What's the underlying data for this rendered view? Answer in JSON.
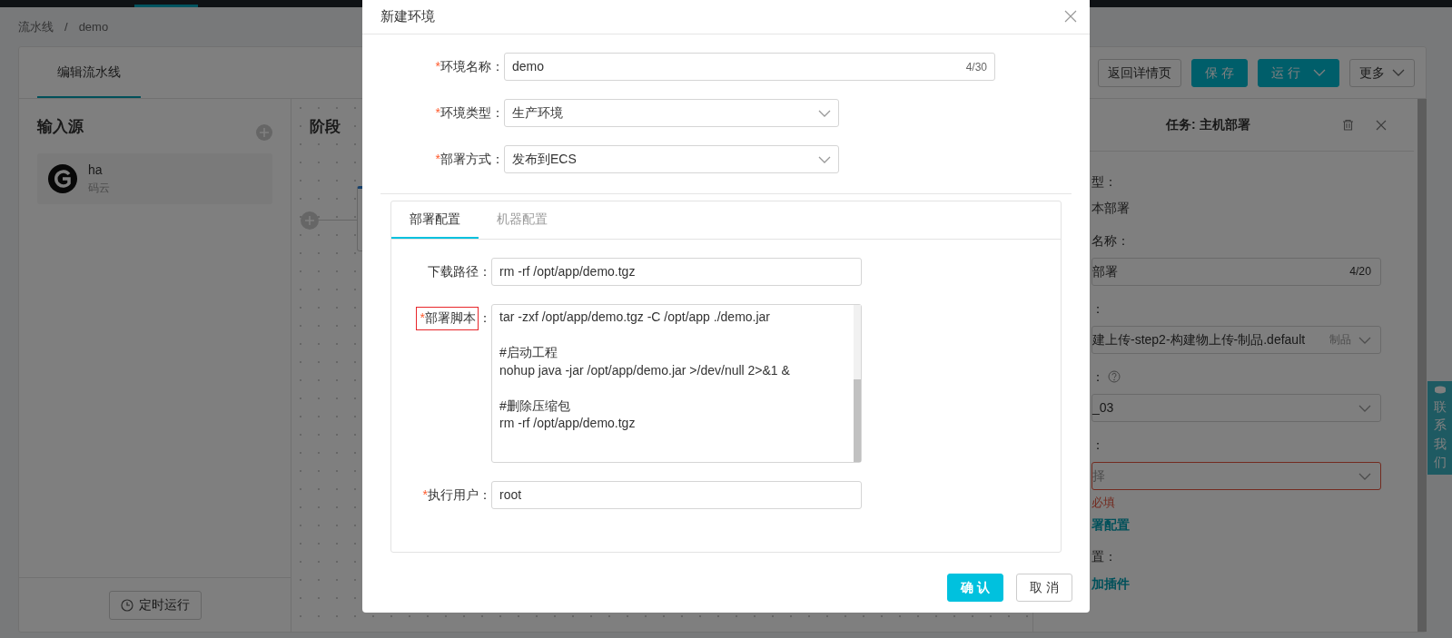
{
  "breadcrumb": {
    "items": [
      "流水线",
      "demo"
    ],
    "separator": "/"
  },
  "page_tabs": [
    {
      "label": "编辑流水线",
      "selected": true
    }
  ],
  "toolbar": [
    {
      "label": "返回详情页",
      "kind": "default"
    },
    {
      "label": "保 存",
      "kind": "primary"
    },
    {
      "label": "运 行",
      "kind": "split"
    },
    {
      "label": "更多",
      "kind": "dropdown"
    }
  ],
  "sources": {
    "title": "输入源",
    "items": [
      {
        "name": "ha",
        "provider": "码云"
      }
    ]
  },
  "schedule_button": "定时运行",
  "stages": {
    "title": "阶段"
  },
  "task_panel": {
    "title": "任务: 主机部署",
    "rows": [
      {
        "kind": "text",
        "label": "型：",
        "value": "本部署"
      },
      {
        "kind": "input",
        "label": "名称：",
        "value": "部署",
        "counter": "4/20"
      },
      {
        "kind": "select",
        "label": "：",
        "value": "建上传-step2-构建物上传-制品.default",
        "suffix": "制品"
      },
      {
        "kind": "select",
        "label": "：",
        "help": true,
        "value": "_03"
      },
      {
        "kind": "select",
        "label": "：",
        "placeholder": "择",
        "error": "必填",
        "link": "署配置"
      },
      {
        "kind": "link",
        "label": "置：",
        "link": "加插件"
      }
    ]
  },
  "contact_tab": "联系我们",
  "modal": {
    "title": "新建环境",
    "required_mark": "*",
    "fields": [
      {
        "kind": "input",
        "label": "环境名称",
        "label_suffix": "：",
        "required": true,
        "value": "demo",
        "counter": "4/30"
      },
      {
        "kind": "select",
        "label": "环境类型",
        "label_suffix": "：",
        "required": true,
        "value": "生产环境"
      },
      {
        "kind": "select",
        "label": "部署方式",
        "label_suffix": "：",
        "required": true,
        "value": "发布到ECS"
      }
    ],
    "tabs": [
      {
        "label": "部署配置",
        "selected": true
      },
      {
        "label": "机器配置",
        "selected": false
      }
    ],
    "tab_fields": [
      {
        "kind": "input",
        "label": "下载路径",
        "label_suffix": "：",
        "required": false,
        "highlighted": false,
        "value": "rm -rf /opt/app/demo.tgz"
      },
      {
        "kind": "script",
        "label": "部署脚本",
        "label_suffix": "：",
        "required": true,
        "highlighted": true,
        "value": "tar -zxf /opt/app/demo.tgz -C /opt/app ./demo.jar\n\n#启动工程\nnohup java -jar /opt/app/demo.jar >/dev/null 2>&1 &\n\n#删除压缩包\nrm -rf /opt/app/demo.tgz"
      },
      {
        "kind": "input",
        "label": "执行用户",
        "label_suffix": "：",
        "required": true,
        "highlighted": false,
        "value": "root"
      }
    ],
    "buttons": [
      {
        "label": "确 认",
        "kind": "primary"
      },
      {
        "label": "取 消",
        "kind": "default"
      }
    ]
  }
}
